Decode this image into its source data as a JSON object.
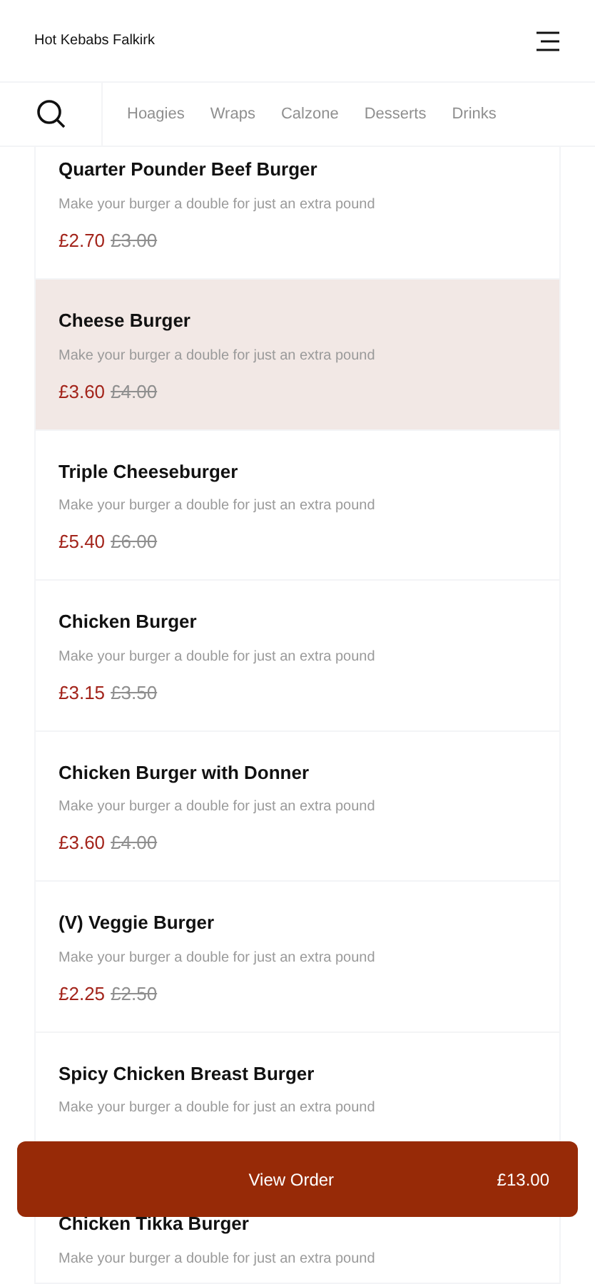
{
  "header": {
    "title": "Hot Kebabs Falkirk"
  },
  "categories": [
    {
      "label": "Hoagies",
      "selected": false
    },
    {
      "label": "Wraps",
      "selected": false
    },
    {
      "label": "Calzone",
      "selected": false
    },
    {
      "label": "Desserts",
      "selected": false
    },
    {
      "label": "Drinks",
      "selected": false
    }
  ],
  "items": [
    {
      "name": "Quarter Pounder Beef Burger",
      "description": "Make your burger a double for just an extra pound",
      "price": "£2.70",
      "old_price": "£3.00",
      "selected": false
    },
    {
      "name": "Cheese Burger",
      "description": "Make your burger a double for just an extra pound",
      "price": "£3.60",
      "old_price": "£4.00",
      "selected": true
    },
    {
      "name": "Triple Cheeseburger",
      "description": "Make your burger a double for just an extra pound",
      "price": "£5.40",
      "old_price": "£6.00",
      "selected": false
    },
    {
      "name": "Chicken Burger",
      "description": "Make your burger a double for just an extra pound",
      "price": "£3.15",
      "old_price": "£3.50",
      "selected": false
    },
    {
      "name": "Chicken Burger with Donner",
      "description": "Make your burger a double for just an extra pound",
      "price": "£3.60",
      "old_price": "£4.00",
      "selected": false
    },
    {
      "name": "(V) Veggie Burger",
      "description": "Make your burger a double for just an extra pound",
      "price": "£2.25",
      "old_price": "£2.50",
      "selected": false
    },
    {
      "name": "Spicy Chicken Breast Burger",
      "description": "Make your burger a double for just an extra pound",
      "selected": false
    },
    {
      "name": "Chicken Tikka Burger",
      "description": "Make your burger a double for just an extra pound",
      "selected": false
    }
  ],
  "order_button": {
    "label": "View Order",
    "total": "£13.00"
  }
}
